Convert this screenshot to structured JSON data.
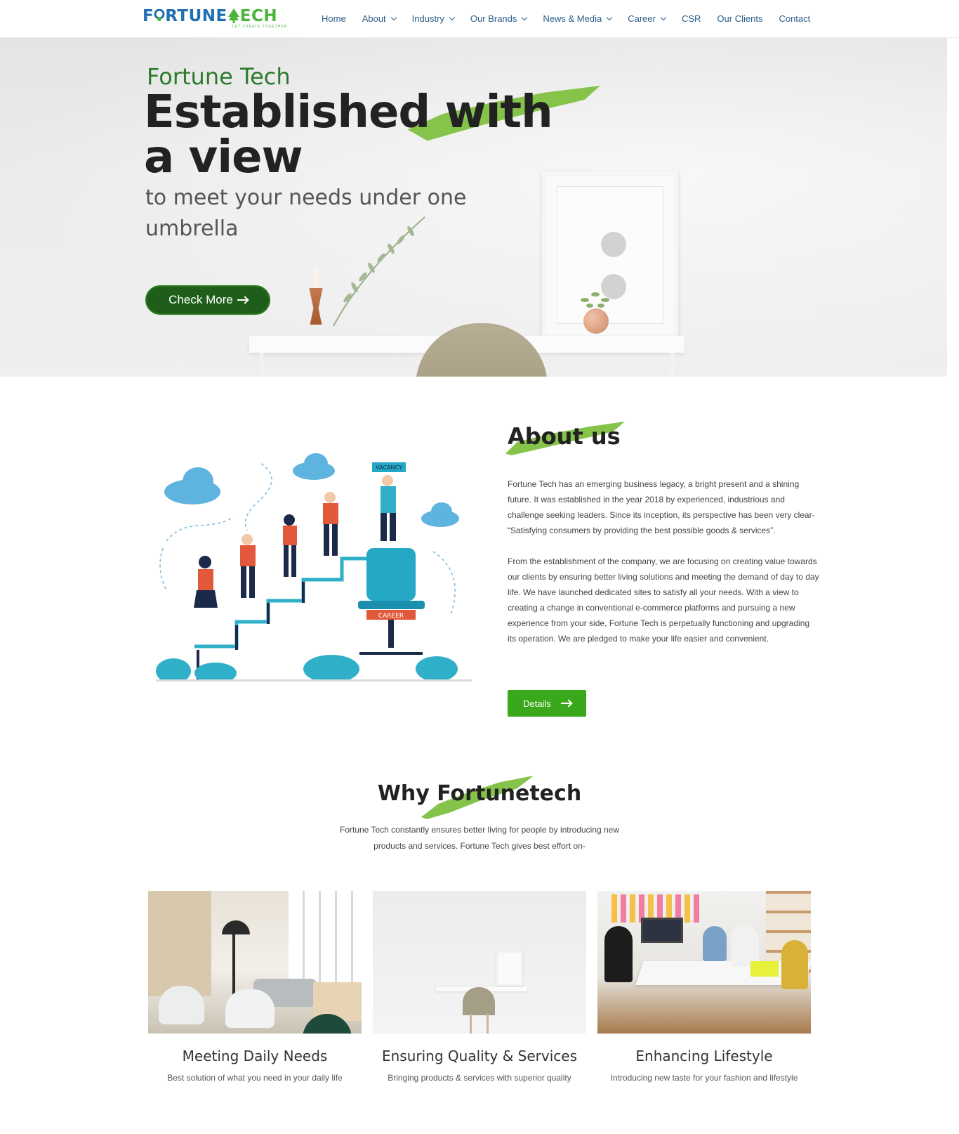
{
  "brand": {
    "logo_part1": "F",
    "logo_part2": "RTUNE",
    "logo_part3": "ECH",
    "logo_tagline": "LET CREATE TOGETHER"
  },
  "nav": {
    "items": [
      {
        "label": "Home",
        "has_dropdown": false
      },
      {
        "label": "About",
        "has_dropdown": true
      },
      {
        "label": "Industry",
        "has_dropdown": true
      },
      {
        "label": "Our Brands",
        "has_dropdown": true
      },
      {
        "label": "News & Media",
        "has_dropdown": true
      },
      {
        "label": "Career",
        "has_dropdown": true
      },
      {
        "label": "CSR",
        "has_dropdown": false
      },
      {
        "label": "Our Clients",
        "has_dropdown": false
      },
      {
        "label": "Contact",
        "has_dropdown": false
      }
    ]
  },
  "hero": {
    "kicker": "Fortune Tech",
    "title_line1": "Established with",
    "title_line2": "a view",
    "subtitle": "to meet your needs under one umbrella",
    "button_label": "Check More"
  },
  "about": {
    "title": "About us",
    "paragraph1": "Fortune Tech has an emerging business legacy, a bright present and a shining future. It was established in the year 2018 by experienced, industrious and challenge seeking leaders. Since its inception, its perspective has been very clear- “Satisfying consumers by providing the best possible goods & services”.",
    "paragraph2": "From the establishment of the company, we are focusing on creating value towards our clients by ensuring better living solutions and meeting the demand of day to day life. We have launched dedicated sites to satisfy all your needs. With a view to creating a change in conventional e-commerce platforms and pursuing a new experience from your side, Fortune Tech is perpetually functioning and upgrading its operation. We are pledged to make your life easier and convenient.",
    "button_label": "Details",
    "illustration_signs": {
      "vacancy": "VACANCY",
      "career": "CAREER"
    }
  },
  "why": {
    "title": "Why Fortunetech",
    "description": "Fortune Tech constantly ensures better living for people by introducing new products and services. Fortune Tech gives best effort on-",
    "cards": [
      {
        "title": "Meeting Daily Needs",
        "text": "Best solution of what you need in your daily life"
      },
      {
        "title": "Ensuring Quality & Services",
        "text": "Bringing products & services with superior quality"
      },
      {
        "title": "Enhancing Lifestyle",
        "text": "Introducing new taste for your fashion and lifestyle"
      }
    ]
  },
  "colors": {
    "brand_blue": "#1f6fb2",
    "brand_green": "#4ab53a",
    "brush_green": "#7fc041",
    "hero_button": "#1f5e1a",
    "details_button": "#3aa81b",
    "nav_text": "#2a5d8a"
  }
}
